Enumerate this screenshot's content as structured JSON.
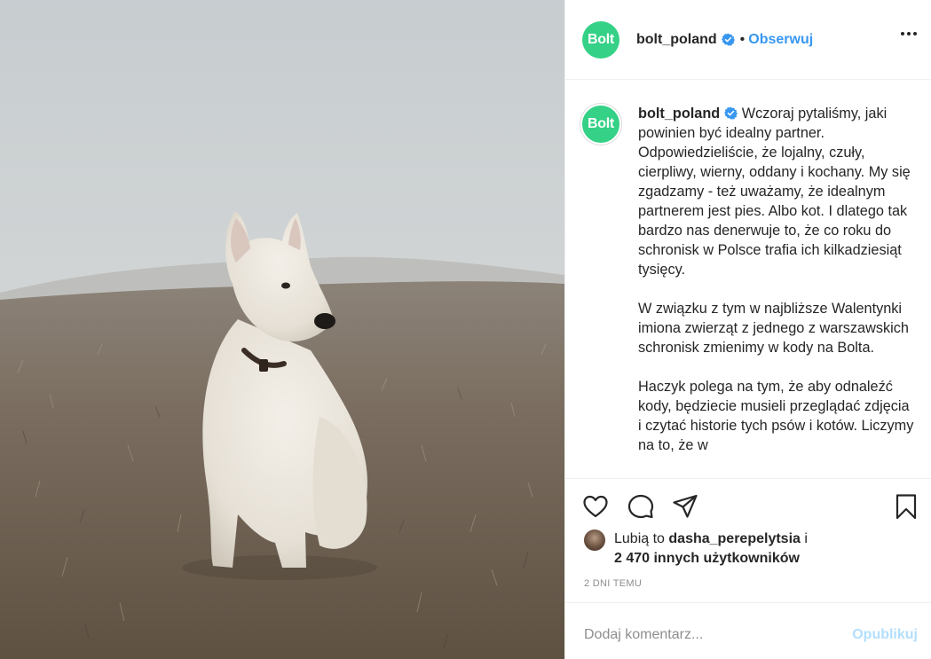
{
  "header": {
    "avatar_text": "Bolt",
    "username": "bolt_poland",
    "separator": "•",
    "follow_label": "Obserwuj"
  },
  "caption": {
    "avatar_text": "Bolt",
    "username": "bolt_poland",
    "paragraphs": [
      "Wczoraj pytaliśmy, jaki powinien być idealny partner. Odpowiedzieliście, że lojalny, czuły, cierpliwy, wierny, oddany i kochany. My się zgadzamy - też uważamy, że idealnym partnerem jest pies. Albo kot. I dlatego tak bardzo nas denerwuje to, że co roku do schronisk w Polsce trafia ich kilkadziesiąt tysięcy.",
      "W związku z tym w najbliższe Walentynki imiona zwierząt z jednego z warszawskich schronisk zmienimy w kody na Bolta.",
      "Haczyk polega na tym, że aby odnaleźć kody, będziecie musieli przeglądać zdjęcia i czytać historie tych psów i kotów. Liczymy na to, że w"
    ]
  },
  "likes": {
    "prefix": "Lubią to",
    "user": "dasha_perepelytsia",
    "conj": "i",
    "others": "2 470 innych użytkowników"
  },
  "time_ago": "2 DNI TEMU",
  "comment": {
    "placeholder": "Dodaj komentarz...",
    "publish_label": "Opublikuj"
  },
  "colors": {
    "brand_green": "#34d186",
    "link_blue": "#3897f0",
    "verified_blue": "#3897f0",
    "publish_disabled": "#b2dffc",
    "muted_text": "#8e8e8e"
  },
  "icons": [
    "heart-icon",
    "comment-icon",
    "share-icon",
    "bookmark-icon",
    "more-options-icon",
    "verified-badge-icon"
  ]
}
